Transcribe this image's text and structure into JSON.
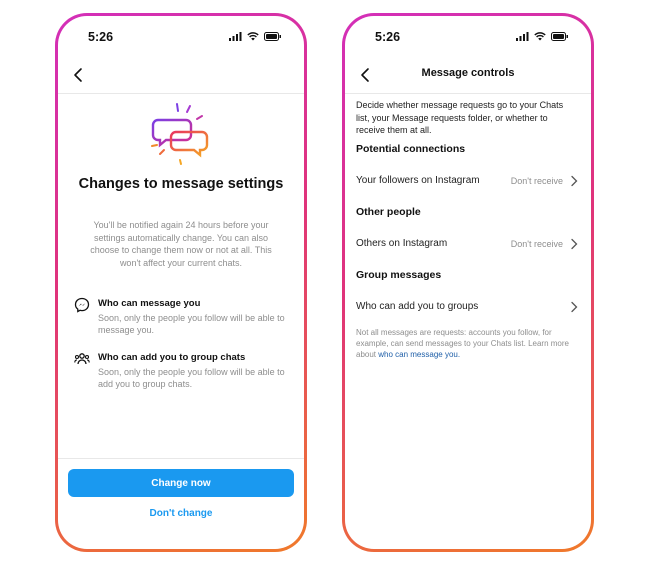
{
  "left_screen": {
    "status_time": "5:26",
    "title": "Changes to message settings",
    "description": "You'll be notified again 24 hours before your settings automatically change. You can also choose to change them now or not at all. This won't affect your current chats.",
    "features": [
      {
        "icon": "messenger-icon",
        "title": "Who can message you",
        "description": "Soon, only the people you follow will be able to message you."
      },
      {
        "icon": "group-icon",
        "title": "Who can add you to group chats",
        "description": "Soon, only the people you follow will be able to add you to group chats."
      }
    ],
    "primary_button": "Change now",
    "secondary_button": "Don't change"
  },
  "right_screen": {
    "status_time": "5:26",
    "title": "Message controls",
    "intro": "Decide whether message requests go to your Chats list, your Message requests folder, or whether to receive them at all.",
    "sections": [
      {
        "heading": "Potential connections",
        "row_label": "Your followers on Instagram",
        "row_value": "Don't receive"
      },
      {
        "heading": "Other people",
        "row_label": "Others on Instagram",
        "row_value": "Don't receive"
      },
      {
        "heading": "Group messages",
        "row_label": "Who can add you to groups",
        "row_value": ""
      }
    ],
    "note": "Not all messages are requests: accounts you follow, for example, can send messages to your Chats list. Learn more about ",
    "note_link": "who can message you."
  },
  "colors": {
    "accent_blue": "#1a99f0",
    "link_blue": "#1f5fa8",
    "frame_gradient": [
      "#d32fb9",
      "#e0337a",
      "#f07a2a"
    ]
  }
}
